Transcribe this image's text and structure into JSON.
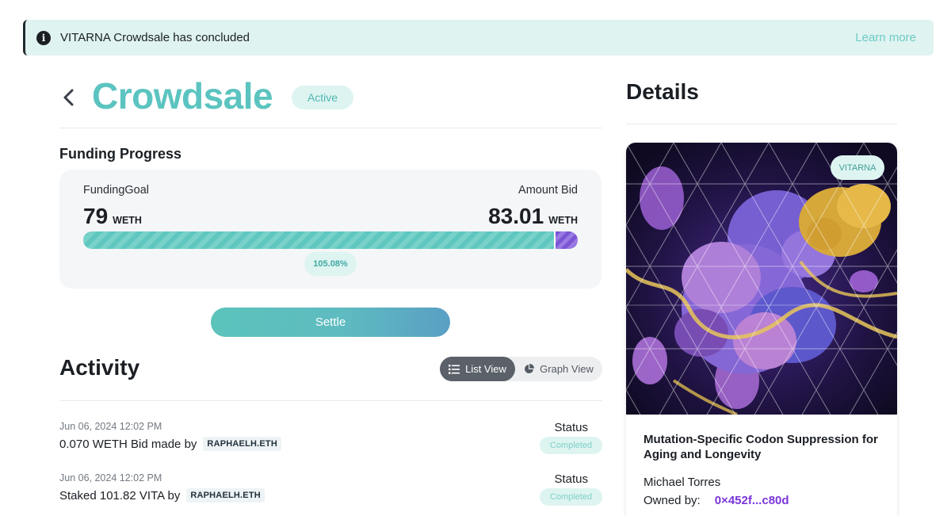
{
  "banner": {
    "message": "VITARNA Crowdsale has concluded",
    "link": "Learn more",
    "icon": "info-icon"
  },
  "header": {
    "title": "Crowdsale",
    "status": "Active",
    "back_icon": "chevron-left-icon"
  },
  "funding": {
    "heading": "Funding Progress",
    "goal_label": "FundingGoal",
    "goal_value": "79",
    "goal_unit": "WETH",
    "bid_label": "Amount Bid",
    "bid_value": "83.01",
    "bid_unit": "WETH",
    "percent_label": "105.08%",
    "percent": 105.08
  },
  "settle_label": "Settle",
  "activity": {
    "heading": "Activity",
    "views": [
      {
        "label": "List View",
        "icon": "list-icon",
        "active": true
      },
      {
        "label": "Graph View",
        "icon": "pie-chart-icon",
        "active": false
      }
    ],
    "rows": [
      {
        "date": "Jun 06, 2024 12:02 PM",
        "text": "0.070 WETH Bid made by",
        "address": "RAPHAELH.ETH",
        "status_label": "Status",
        "status": "Completed"
      },
      {
        "date": "Jun 06, 2024 12:02 PM",
        "text": "Staked 101.82 VITA by",
        "address": "RAPHAELH.ETH",
        "status_label": "Status",
        "status": "Completed"
      }
    ]
  },
  "details": {
    "heading": "Details",
    "tag": "VITARNA",
    "project_title": "Mutation-Specific Codon Suppression for Aging and Longevity",
    "author": "Michael Torres",
    "owned_label": "Owned by:",
    "owner": "0×452f...c80d"
  },
  "colors": {
    "accent": "#5cc4c0",
    "over": "#7b55d4",
    "owner": "#7b35d9"
  }
}
